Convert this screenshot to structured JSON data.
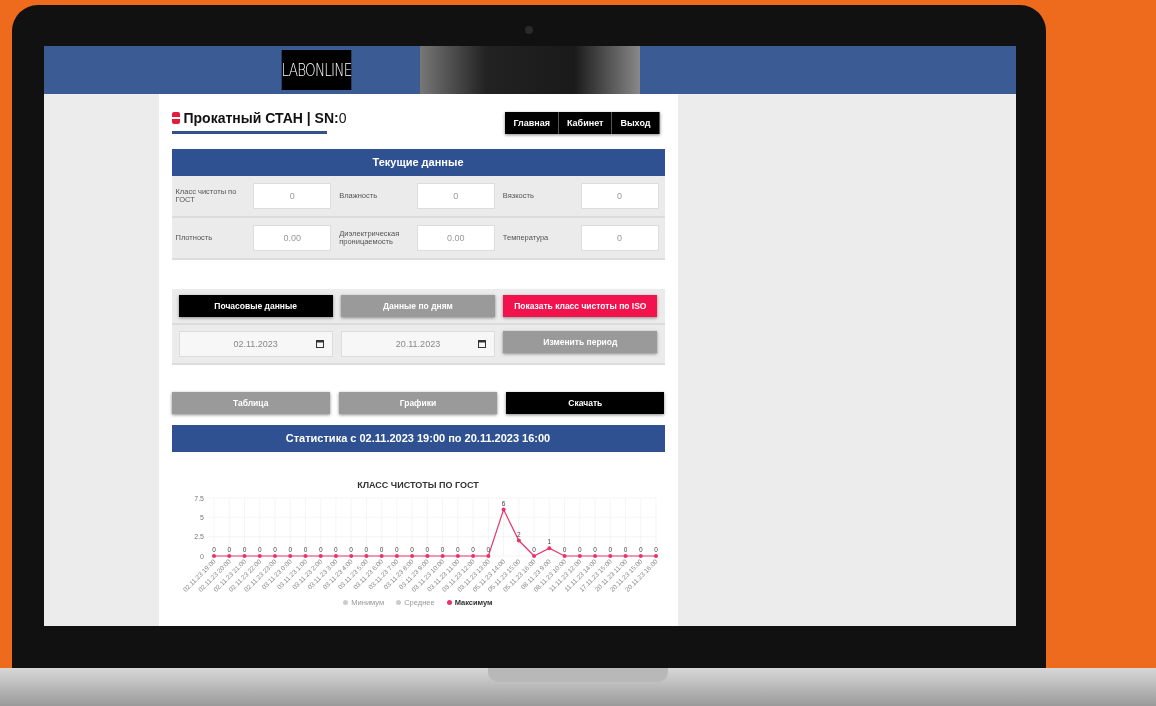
{
  "header": {
    "logo": "LABONLINE"
  },
  "device": {
    "title": "**Прокатный СТАН | SN:**0"
  },
  "nav": [
    {
      "label": "Главная"
    },
    {
      "label": "Кабинет"
    },
    {
      "label": "Выход"
    }
  ],
  "current": {
    "heading": "Текущие данные",
    "fields": [
      {
        "label": "Класс чистоты по ГОСТ",
        "value": "0"
      },
      {
        "label": "Влажность",
        "value": "0"
      },
      {
        "label": "Вязкость",
        "value": "0"
      },
      {
        "label": "Плотность",
        "value": "0.00"
      },
      {
        "label": "Диэлектрическая проницаемость",
        "value": "0.00"
      },
      {
        "label": "Температура",
        "value": "0"
      }
    ]
  },
  "period": {
    "buttons": [
      {
        "label": "Почасовые данные",
        "kind": "dark"
      },
      {
        "label": "Данные по дням",
        "kind": "muted"
      },
      {
        "label": "Показать класс чистоты по ISO",
        "kind": "accent"
      }
    ],
    "date_from": "02.11.2023",
    "date_to": "20.11.2023",
    "apply": {
      "label": "Изменить период",
      "kind": "muted"
    }
  },
  "views": [
    {
      "label": "Таблица",
      "kind": "muted"
    },
    {
      "label": "Графики",
      "kind": "muted"
    },
    {
      "label": "Скачать",
      "kind": "dark"
    }
  ],
  "stats_heading": "Статистика с 02.11.2023 19:00 по 20.11.2023 16:00",
  "chart": {
    "chart_data": {
      "type": "line",
      "title": "КЛАСС ЧИСТОТЫ ПО ГОСТ",
      "grid": true,
      "categories": [
        "02.11.23 19:00",
        "02.11.23 20:00",
        "02.11.23 21:00",
        "02.11.23 22:00",
        "02.11.23 23:00",
        "03.11.23 0:00",
        "03.11.23 1:00",
        "03.11.23 2:00",
        "03.11.23 3:00",
        "03.11.23 4:00",
        "03.11.23 5:00",
        "03.11.23 6:00",
        "03.11.23 7:00",
        "03.11.23 8:00",
        "03.11.23 9:00",
        "03.11.23 10:00",
        "03.11.23 11:00",
        "03.11.23 12:00",
        "03.11.23 13:00",
        "05.11.23 14:00",
        "05.11.23 15:00",
        "05.11.23 16:00",
        "08.11.23 9:00",
        "08.11.23 10:00",
        "11.11.23 12:00",
        "11.11.23 14:00",
        "17.11.23 15:00",
        "20.11.23 11:00",
        "20.11.23 15:00",
        "20.11.23 16:00"
      ],
      "series": [
        {
          "name": "Минимум",
          "color": "#cccccc",
          "values": [
            null,
            null,
            null,
            null,
            null,
            null,
            null,
            null,
            null,
            null,
            null,
            null,
            null,
            null,
            null,
            null,
            null,
            null,
            null,
            null,
            null,
            null,
            null,
            null,
            null,
            null,
            null,
            null,
            null,
            null
          ]
        },
        {
          "name": "Среднее",
          "color": "#cccccc",
          "values": [
            null,
            null,
            null,
            null,
            null,
            null,
            null,
            null,
            null,
            null,
            null,
            null,
            null,
            null,
            null,
            null,
            null,
            null,
            null,
            null,
            null,
            null,
            null,
            null,
            null,
            null,
            null,
            null,
            null,
            null
          ]
        },
        {
          "name": "Максимум",
          "color": "#e8336a",
          "values": [
            0,
            0,
            0,
            0,
            0,
            0,
            0,
            0,
            0,
            0,
            0,
            0,
            0,
            0,
            0,
            0,
            0,
            0,
            0,
            6,
            2,
            0,
            1,
            0,
            0,
            0,
            0,
            0,
            0,
            0
          ]
        }
      ],
      "ylim": [
        0,
        7.5
      ],
      "yticks": [
        0,
        2.5,
        5,
        7.5
      ],
      "data_labels": true
    }
  }
}
